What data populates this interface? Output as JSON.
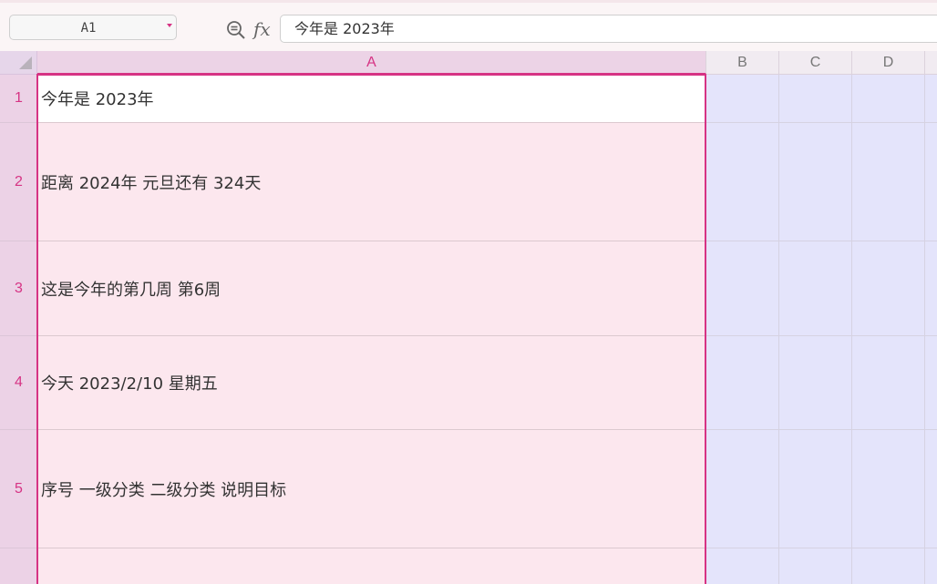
{
  "formula_bar": {
    "name_box": "A1",
    "formula": "今年是 2023年"
  },
  "columns": [
    "A",
    "B",
    "C",
    "D"
  ],
  "rows": [
    {
      "number": "1",
      "a": "今年是 2023年"
    },
    {
      "number": "2",
      "a": "距离 2024年 元旦还有 324天"
    },
    {
      "number": "3",
      "a": "这是今年的第几周 第6周"
    },
    {
      "number": "4",
      "a": "今天 2023/2/10 星期五"
    },
    {
      "number": "5",
      "a": "序号 一级分类 二级分类 说明目标"
    },
    {
      "number": "",
      "a": ""
    }
  ],
  "colors": {
    "accent": "#d63384",
    "column_a_fill": "#fce7ee",
    "other_columns_fill": "#e4e4fb"
  },
  "icons": {
    "zoom": "zoom-formula-icon",
    "fx": "function-icon",
    "dropdown": "chevron-down-icon",
    "select_all": "select-all-icon"
  }
}
